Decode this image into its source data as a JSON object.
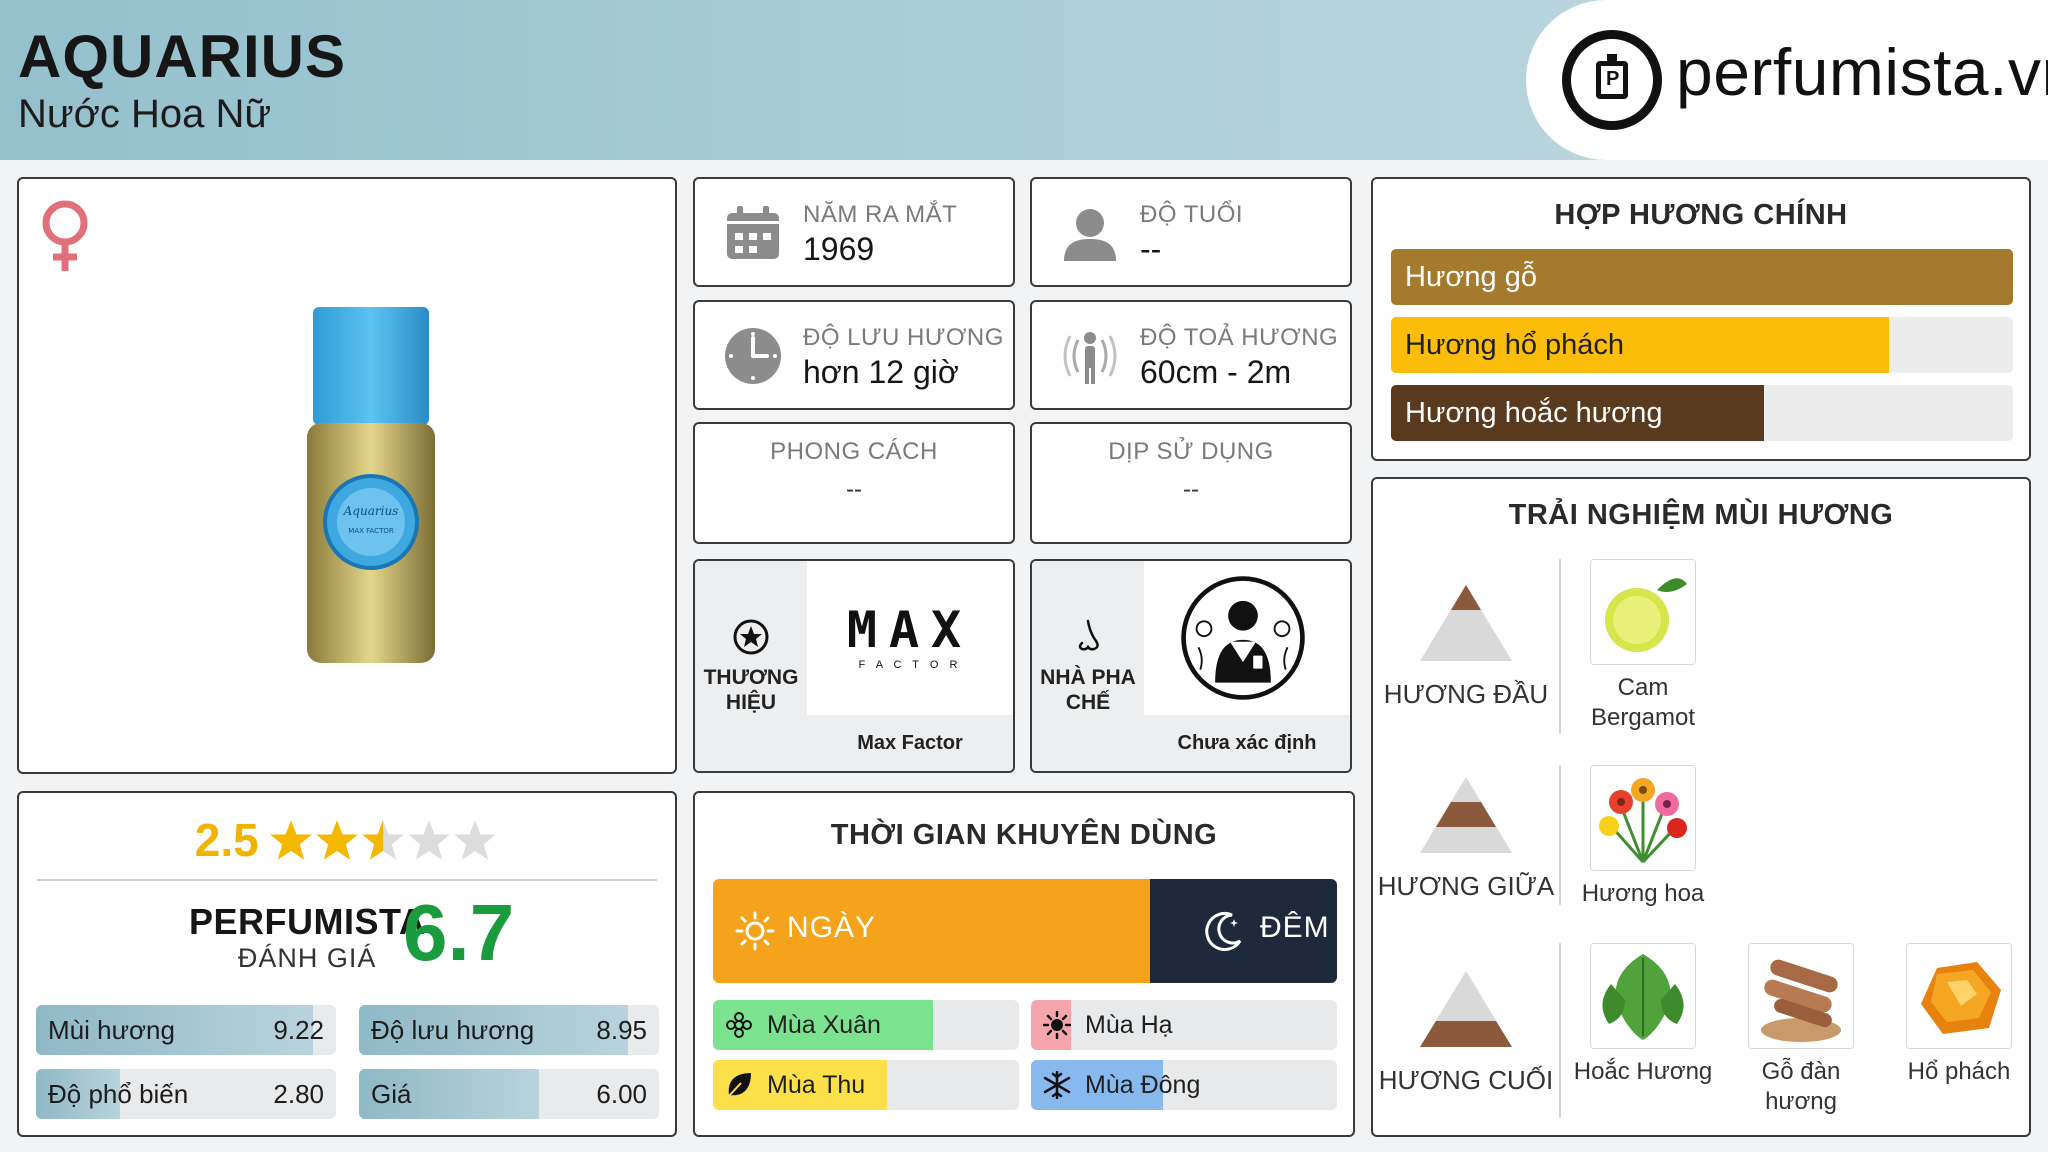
{
  "header": {
    "title": "AQUARIUS",
    "subtitle": "Nước Hoa Nữ",
    "logo_text": "perfumista.vn"
  },
  "product": {
    "gender_icon": "female-symbol-icon",
    "image_icon": "perfume-bottle-icon"
  },
  "rating": {
    "value": "2.5",
    "stars_total": 5,
    "stars_filled": 2.5,
    "brand_label": "PERFUMISTA",
    "brand_sublabel": "ĐÁNH GIÁ",
    "score": "6.7",
    "metrics": [
      {
        "name": "Mùi hương",
        "value": "9.22",
        "fraction": 0.922
      },
      {
        "name": "Độ lưu hương",
        "value": "8.95",
        "fraction": 0.895
      },
      {
        "name": "Độ phổ biến",
        "value": "2.80",
        "fraction": 0.28
      },
      {
        "name": "Giá",
        "value": "6.00",
        "fraction": 0.6
      }
    ]
  },
  "info": {
    "launch": {
      "label": "NĂM RA MẮT",
      "value": "1969",
      "icon": "calendar-icon"
    },
    "age": {
      "label": "ĐỘ TUỔI",
      "value": "--",
      "icon": "person-icon"
    },
    "longevity": {
      "label": "ĐỘ LƯU HƯƠNG",
      "value": "hơn 12 giờ",
      "icon": "clock-icon"
    },
    "sillage": {
      "label": "ĐỘ TOẢ HƯƠNG",
      "value": "60cm - 2m",
      "icon": "diffusion-icon"
    },
    "style": {
      "label": "PHONG CÁCH",
      "value": "--"
    },
    "occasion": {
      "label": "DỊP SỬ DỤNG",
      "value": "--"
    }
  },
  "brand": {
    "label_line1": "THƯƠNG",
    "label_line2": "HIỆU",
    "logo_line1": "MAX",
    "logo_line2": "F A C T O R",
    "name": "Max Factor",
    "icon": "star-badge-icon"
  },
  "perfumer": {
    "label_line1": "NHÀ PHA",
    "label_line2": "CHẾ",
    "name": "Chưa xác định",
    "icon": "nose-icon",
    "image_icon": "perfumer-portrait-icon"
  },
  "recommended_time": {
    "title": "THỜI GIAN KHUYÊN DÙNG",
    "day_label": "NGÀY",
    "night_label": "ĐÊM",
    "day_fraction": 0.7,
    "seasons": [
      {
        "name": "Mùa Xuân",
        "fraction": 0.72,
        "color": "#7be38f",
        "icon": "flower-icon"
      },
      {
        "name": "Mùa Hạ",
        "fraction": 0.13,
        "color": "#f7a5ad",
        "icon": "sun-icon"
      },
      {
        "name": "Mùa Thu",
        "fraction": 0.57,
        "color": "#fbe04a",
        "icon": "leaf-icon"
      },
      {
        "name": "Mùa Đông",
        "fraction": 0.43,
        "color": "#87b9ef",
        "icon": "snowflake-icon"
      }
    ]
  },
  "accords": {
    "title": "HỢP HƯƠNG CHÍNH",
    "items": [
      {
        "name": "Hương gỗ",
        "fraction": 1.0,
        "color": "#a47a2e",
        "text_color": "#ffffff"
      },
      {
        "name": "Hương hổ phách",
        "fraction": 0.8,
        "color": "#fbbd0a",
        "text_color": "#1f1f1f"
      },
      {
        "name": "Hương hoắc hương",
        "fraction": 0.6,
        "color": "#5a3a1e",
        "text_color": "#ffffff"
      }
    ]
  },
  "notes": {
    "title": "TRẢI NGHIỆM MÙI HƯƠNG",
    "top": {
      "label": "HƯƠNG ĐẦU",
      "items": [
        {
          "name_line1": "Cam",
          "name_line2": "Bergamot",
          "icon": "bergamot-icon"
        }
      ]
    },
    "middle": {
      "label": "HƯƠNG GIỮA",
      "items": [
        {
          "name_line1": "Hương hoa",
          "name_line2": "",
          "icon": "flowers-icon"
        }
      ]
    },
    "base": {
      "label": "HƯƠNG CUỐI",
      "items": [
        {
          "name_line1": "Hoắc Hương",
          "name_line2": "",
          "icon": "patchouli-leaf-icon"
        },
        {
          "name_line1": "Gỗ đàn",
          "name_line2": "hương",
          "icon": "sandalwood-icon"
        },
        {
          "name_line1": "Hổ phách",
          "name_line2": "",
          "icon": "amber-icon"
        }
      ]
    }
  }
}
